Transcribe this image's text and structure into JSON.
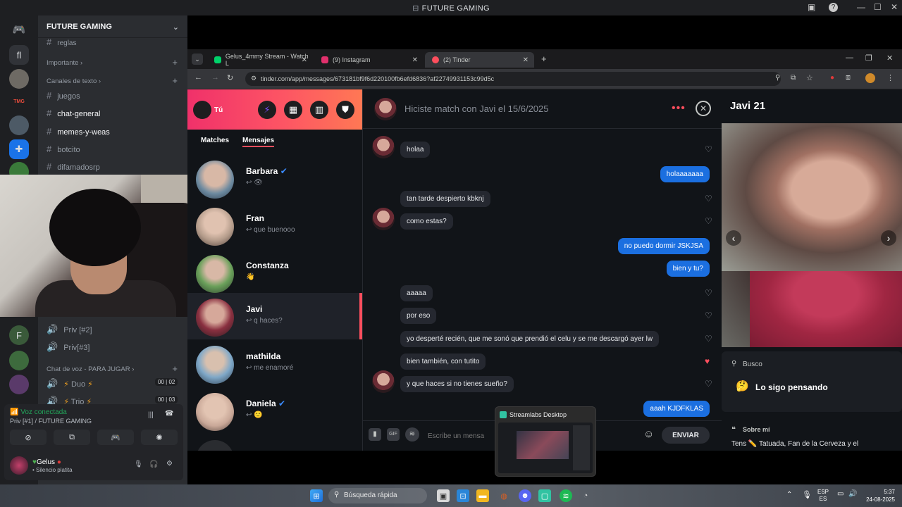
{
  "window": {
    "title": "FUTURE GAMING"
  },
  "discord": {
    "server_name": "FUTURE GAMING",
    "channels_top": [
      "reglas"
    ],
    "category_important": "Importante",
    "category_text": "Canales de texto",
    "text_channels": [
      "juegos",
      "chat-general",
      "memes-y-weas",
      "botcito",
      "difamadosrp"
    ],
    "voice_channels": [
      "Priv [#2]",
      "Priv[#3]"
    ],
    "category_voice_play": "Chat de voz - PARA JUGAR",
    "play_channels": [
      {
        "name": "Duo",
        "count_a": "00",
        "count_b": "02"
      },
      {
        "name": "Trio",
        "count_a": "00",
        "count_b": "03"
      }
    ],
    "voice_status": "Voz conectada",
    "voice_location": "Priv [#1] / FUTURE GAMING",
    "user_name": "Gelus",
    "user_status": "• Silencio platita",
    "rail_label_tmg": "TMG"
  },
  "browser": {
    "tabs": [
      {
        "label": "Gelus_4mmy Stream - Watch L",
        "color": "#00d26a"
      },
      {
        "label": "(9) Instagram",
        "color": "#e1306c"
      },
      {
        "label": "(2) Tinder",
        "color": "#fd4e5d"
      }
    ],
    "url": "tinder.com/app/messages/673181bf9f6d220100fb6efd6836?af22749931153c99d5c"
  },
  "tinder": {
    "user_label": "Tú",
    "tab_matches": "Matches",
    "tab_messages": "Mensajes",
    "conversations": [
      {
        "name": "Barbara",
        "preview": "↩ 👁",
        "verified": true
      },
      {
        "name": "Fran",
        "preview": "↩ que buenooo",
        "verified": false
      },
      {
        "name": "Constanza",
        "preview": "👋",
        "verified": false
      },
      {
        "name": "Javi",
        "preview": "↩ q haces?",
        "verified": false
      },
      {
        "name": "mathilda",
        "preview": "↩ me enamoré",
        "verified": false
      },
      {
        "name": "Daniela",
        "preview": "↩ 🙂",
        "verified": true
      }
    ],
    "match_header": "Hiciste match con Javi el 15/6/2025",
    "messages": [
      {
        "text": "holaa",
        "dir": "in"
      },
      {
        "text": "holaaaaaaa",
        "dir": "out"
      },
      {
        "text": "tan tarde despierto kbknj",
        "dir": "in"
      },
      {
        "text": "como estas?",
        "dir": "in"
      },
      {
        "text": "no puedo dormir JSKJSA",
        "dir": "out"
      },
      {
        "text": "bien y tu?",
        "dir": "out"
      },
      {
        "text": "aaaaa",
        "dir": "in"
      },
      {
        "text": "por eso",
        "dir": "in"
      },
      {
        "text": "yo desperté recién, que me sonó que prendió el celu y se me descargó ayer lw",
        "dir": "in"
      },
      {
        "text": "bien también, con tutito",
        "dir": "in"
      },
      {
        "text": "y que haces si no tienes sueño?",
        "dir": "in"
      },
      {
        "text": "aaah KJDFKLAS",
        "dir": "out"
      }
    ],
    "composer_placeholder": "Escribe un mensa",
    "send_label": "ENVIAR",
    "gif_label": "GIF",
    "profile": {
      "name_age": "Javi 21",
      "busco_label": "Busco",
      "busco_value": "Lo sigo pensando",
      "about_label": "Sobre mí",
      "about_text": "Tens ✏️ Tatuada, Fan de la Cerveza y el"
    }
  },
  "streamlabs": {
    "title": "Streamlabs Desktop"
  },
  "taskbar": {
    "search_placeholder": "Búsqueda rápida",
    "lang_top": "ESP",
    "lang_bottom": "ES",
    "time": "5:37",
    "date": "24-08-2025"
  }
}
